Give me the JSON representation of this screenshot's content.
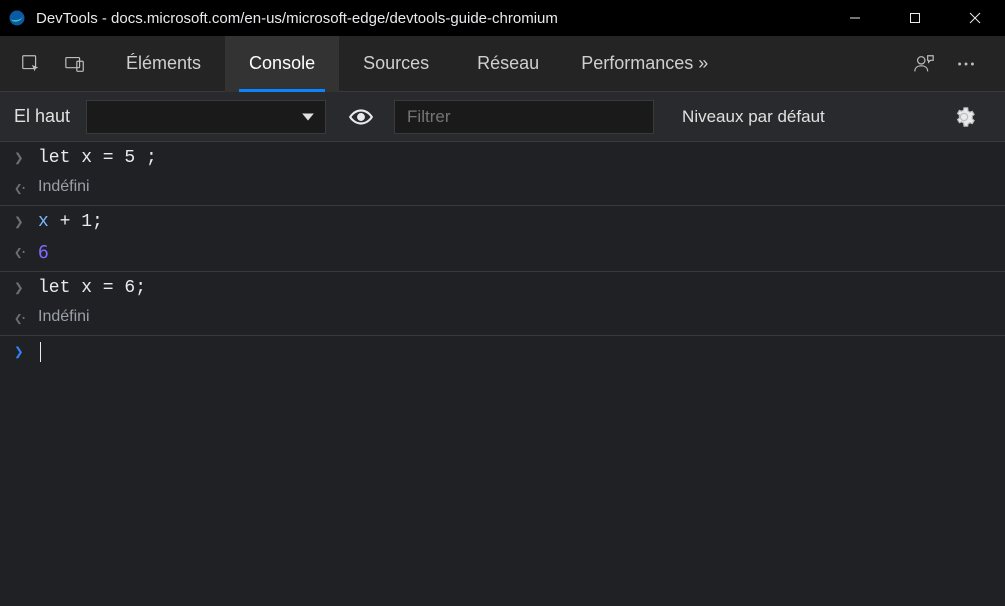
{
  "window": {
    "title": "DevTools - docs.microsoft.com/en-us/microsoft-edge/devtools-guide-chromium"
  },
  "tabs": {
    "elements": "Éléments",
    "console": "Console",
    "sources": "Sources",
    "network": "Réseau",
    "performance": "Performances »"
  },
  "toolbar": {
    "context_label": "El haut",
    "filter_placeholder": "Filtrer",
    "levels_label": "Niveaux par défaut"
  },
  "console": {
    "entries": [
      {
        "input": "let x = 5 ;",
        "output_undef": "Indéfini"
      },
      {
        "input_tokens": {
          "var": "x",
          "rest": " + 1;"
        },
        "output_num": "6"
      },
      {
        "input": "let x = 6;",
        "output_undef": "Indéfini"
      }
    ]
  }
}
